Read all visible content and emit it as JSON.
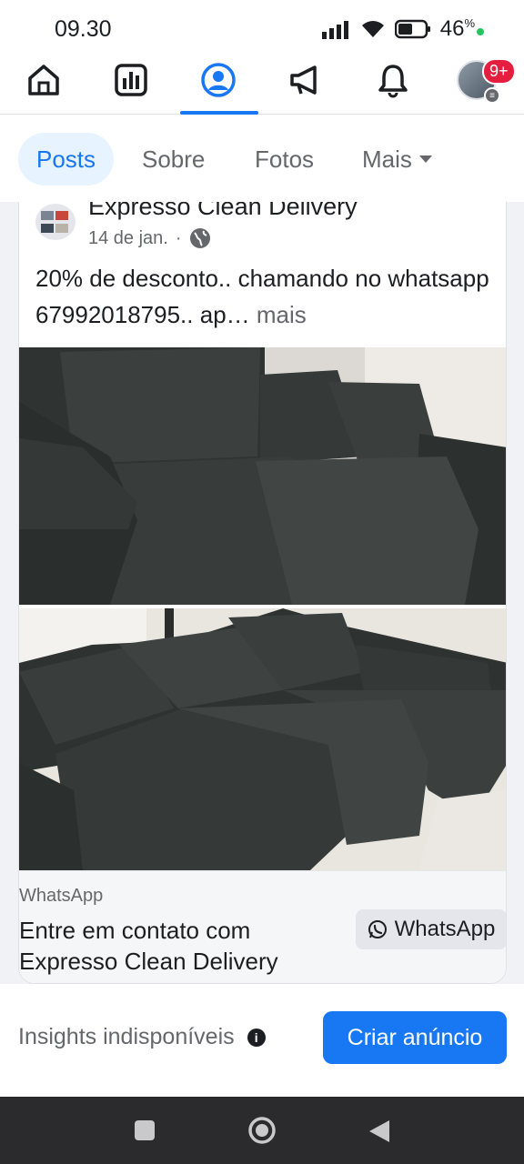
{
  "status_bar": {
    "time": "09.30",
    "battery_percent": "46",
    "battery_unit": "%"
  },
  "top_nav": {
    "icons": [
      "home-icon",
      "dashboard-icon",
      "profile-icon",
      "megaphone-icon",
      "bell-icon",
      "avatar"
    ],
    "active": "profile-icon",
    "notification_badge": "9+"
  },
  "tabs": [
    {
      "label": "Posts",
      "active": true
    },
    {
      "label": "Sobre",
      "active": false
    },
    {
      "label": "Fotos",
      "active": false
    },
    {
      "label": "Mais",
      "active": false
    }
  ],
  "post": {
    "author": "Expresso  Clean Delivery",
    "date": "14 de jan.",
    "date_separator": "·",
    "text": "20%  de desconto.. chamando no whatsapp 67992018795.. ap…",
    "more_label": "mais",
    "cta": {
      "source": "WhatsApp",
      "text": "Entre em contato com Expresso  Clean Delivery",
      "button_label": "WhatsApp"
    }
  },
  "insights": {
    "label": "Insights indisponíveis",
    "button_label": "Criar anúncio"
  },
  "colors": {
    "accent": "#1877f2",
    "badge": "#e41e3f",
    "tab_active_bg": "#e7f3ff"
  }
}
